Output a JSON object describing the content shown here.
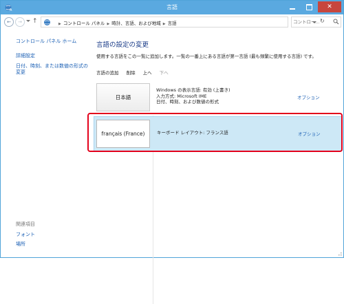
{
  "window": {
    "title": "言語",
    "titlebar_color": "#5aa9e0",
    "close_color": "#c7463d"
  },
  "controls": {
    "minimize_icon": "minimize-icon",
    "maximize_icon": "maximize-icon",
    "close_label": "✕"
  },
  "address": {
    "crumbs": [
      "コントロール パネル",
      "時計、言語、および地域",
      "言語"
    ],
    "search_placeholder": "コントロー..."
  },
  "sidebar": {
    "home": "コントロール パネル ホーム",
    "links": [
      "詳細設定",
      "日付、時刻、または数値の形式の変更"
    ],
    "related_heading": "関連項目",
    "related": [
      "フォント",
      "場所"
    ]
  },
  "main": {
    "heading": "言語の設定の変更",
    "description": "使用する言語をこの一覧に追加します。一覧の一番上にある言語が第一言語 (最も頻繁に使用する言語) です。",
    "toolbar": {
      "add": "言語の追加",
      "remove": "削除",
      "up": "上へ",
      "down": "下へ"
    },
    "languages": [
      {
        "name": "日本語",
        "details": [
          "Windows の表示言語: 有効 (上書き)",
          "入力方式: Microsoft IME",
          "日付、時刻、および数値の形式"
        ],
        "option": "オプション"
      },
      {
        "name": "français (France)",
        "details": [
          "キーボード レイアウト: フランス語"
        ],
        "option": "オプション"
      }
    ]
  },
  "highlight_color": "#e3001b"
}
